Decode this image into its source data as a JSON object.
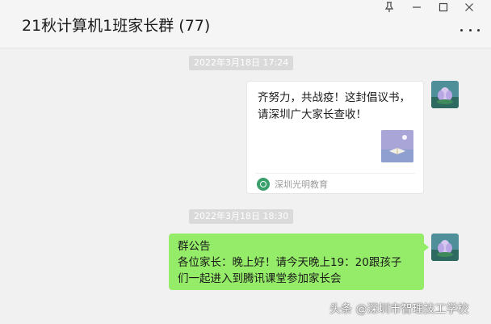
{
  "window": {
    "title": "21秋计算机1班家长群 (77)",
    "controls": {
      "pin": "⚲",
      "minimize": "—",
      "maximize": "☐",
      "close": "✕"
    }
  },
  "messages": [
    {
      "time": "2022年3月18日 17:24",
      "type": "link-card",
      "text": "齐努力，共战疫！这封倡议书，请深圳广大家长查收！",
      "source": "深圳光明教育"
    },
    {
      "time": "2022年3月18日 18:30",
      "type": "text",
      "lines": [
        "群公告",
        "各位家长：晚上好！请今天晚上19：20跟孩子",
        "们一起进入到腾讯课堂参加家长会"
      ]
    }
  ],
  "watermark": "头条 @深圳市智理技工学校",
  "colors": {
    "bubble": "#95ec69",
    "background": "#f1f1f1",
    "time_badge": "#dadada"
  }
}
